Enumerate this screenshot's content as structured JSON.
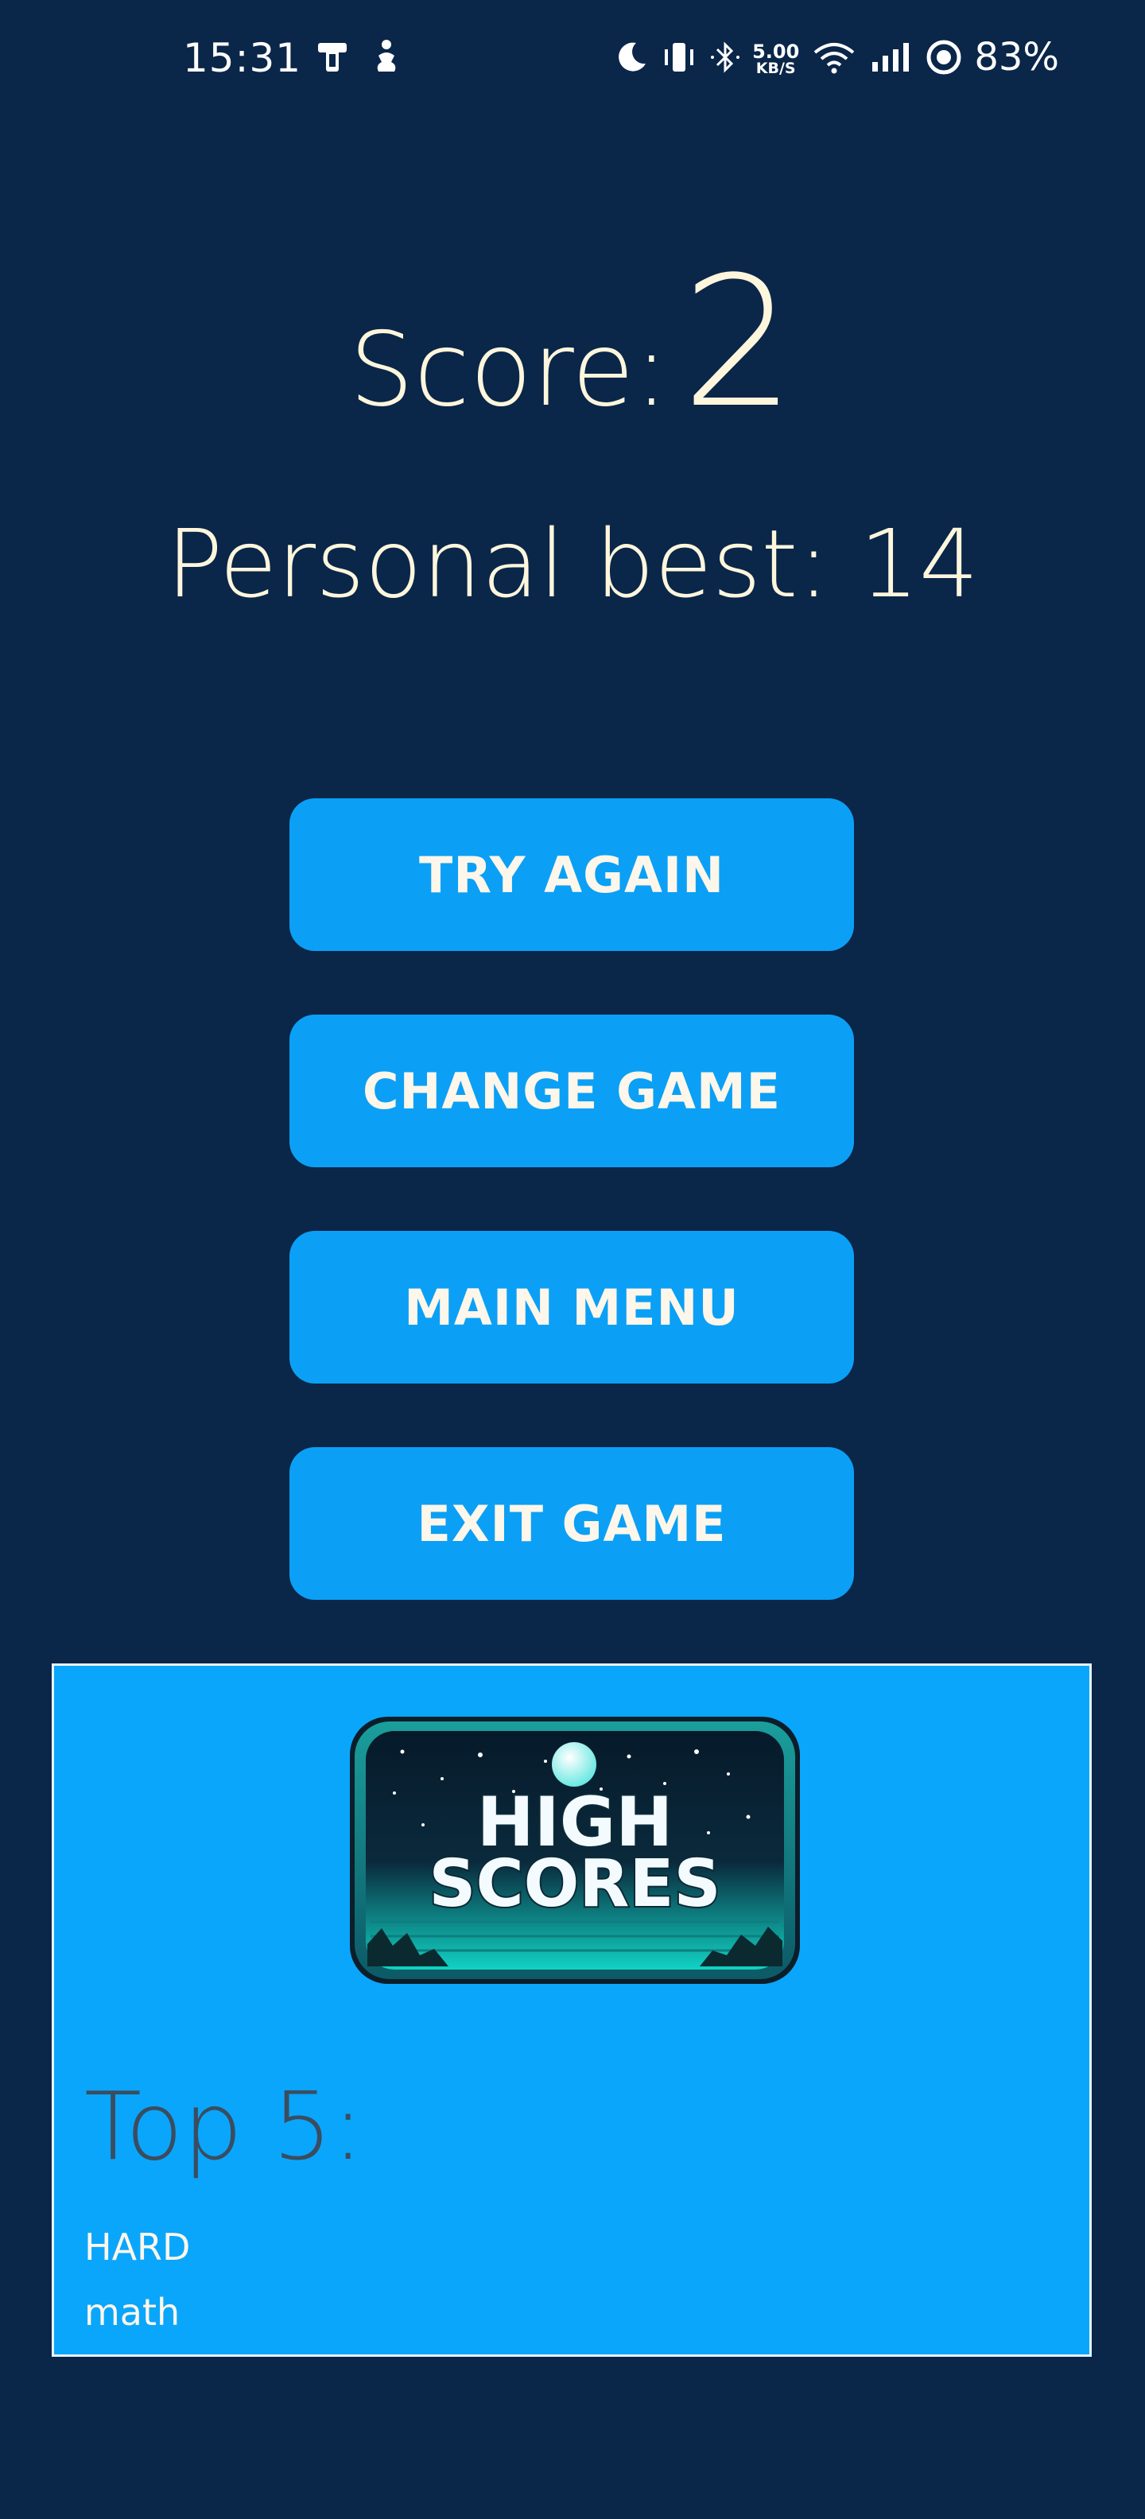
{
  "status_bar": {
    "time": "15:31",
    "net_speed_value": "5.00",
    "net_speed_unit": "KB/S",
    "battery": "83%"
  },
  "score": {
    "label": "Score:",
    "value": "2",
    "personal_best": "Personal best: 14"
  },
  "buttons": {
    "try_again": "TRY AGAIN",
    "change_game": "CHANGE GAME",
    "main_menu": "MAIN MENU",
    "exit_game": "EXIT GAME"
  },
  "high_scores": {
    "logo_line1": "HIGH",
    "logo_line2": "SCORES",
    "title": "Top 5:",
    "items": [
      "HARD",
      "math"
    ]
  },
  "colors": {
    "background": "#0a2649",
    "button": "#0ba0f5",
    "panel": "#0aa6fb",
    "text_cream": "#fdf6dc"
  }
}
